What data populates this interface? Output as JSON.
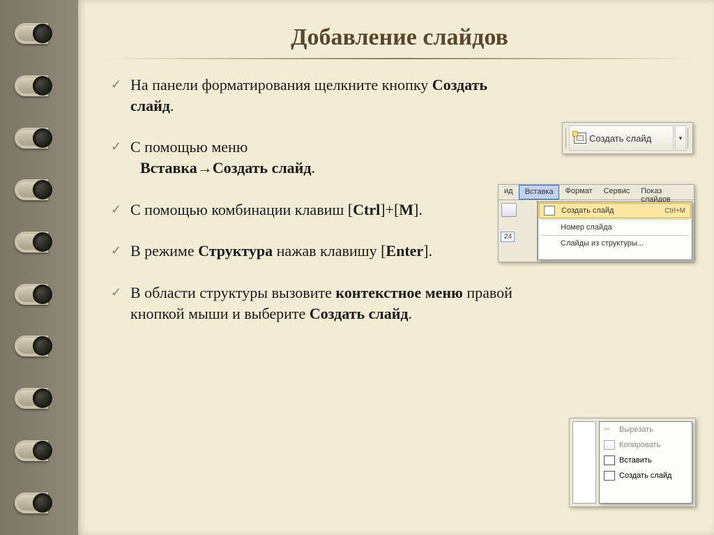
{
  "title": "Добавление слайдов",
  "bullets": [
    {
      "pre": "На панели форматирования щелкните кнопку ",
      "bold": "Создать слайд",
      "post": "."
    },
    {
      "pre": "С помощью меню",
      "indent_bold": "Вставка→Создать слайд",
      "indent_post": "."
    },
    {
      "pre": "С помощью комбинации клавиш [",
      "bold": "Ctrl",
      "mid": "]+[",
      "bold2": "M",
      "post": "]."
    },
    {
      "pre": "В режиме ",
      "bold": "Структура",
      "mid": " нажав клавишу [",
      "bold2": "Enter",
      "post": "]."
    },
    {
      "pre": "В области структуры вызовите ",
      "bold": "контекстное меню",
      "mid": " правой кнопкой мыши и выберите ",
      "bold2": "Создать слайд",
      "post": "."
    }
  ],
  "shot1": {
    "label": "Создать слайд"
  },
  "shot2": {
    "menu": {
      "m1": "ид",
      "m2": "Вставка",
      "m3": "Формат",
      "m4": "Сервис",
      "m5": "Показ слайдов"
    },
    "toolbar_num": "24",
    "items": {
      "i1_label": "Создать слайд",
      "i1_shortcut": "Ctrl+M",
      "i2_label": "Номер слайда",
      "i3_label": "Слайды из структуры..."
    }
  },
  "shot3": {
    "i1": "Вырезать",
    "i2": "Копировать",
    "i3": "Вставить",
    "i4": "Создать слайд"
  }
}
